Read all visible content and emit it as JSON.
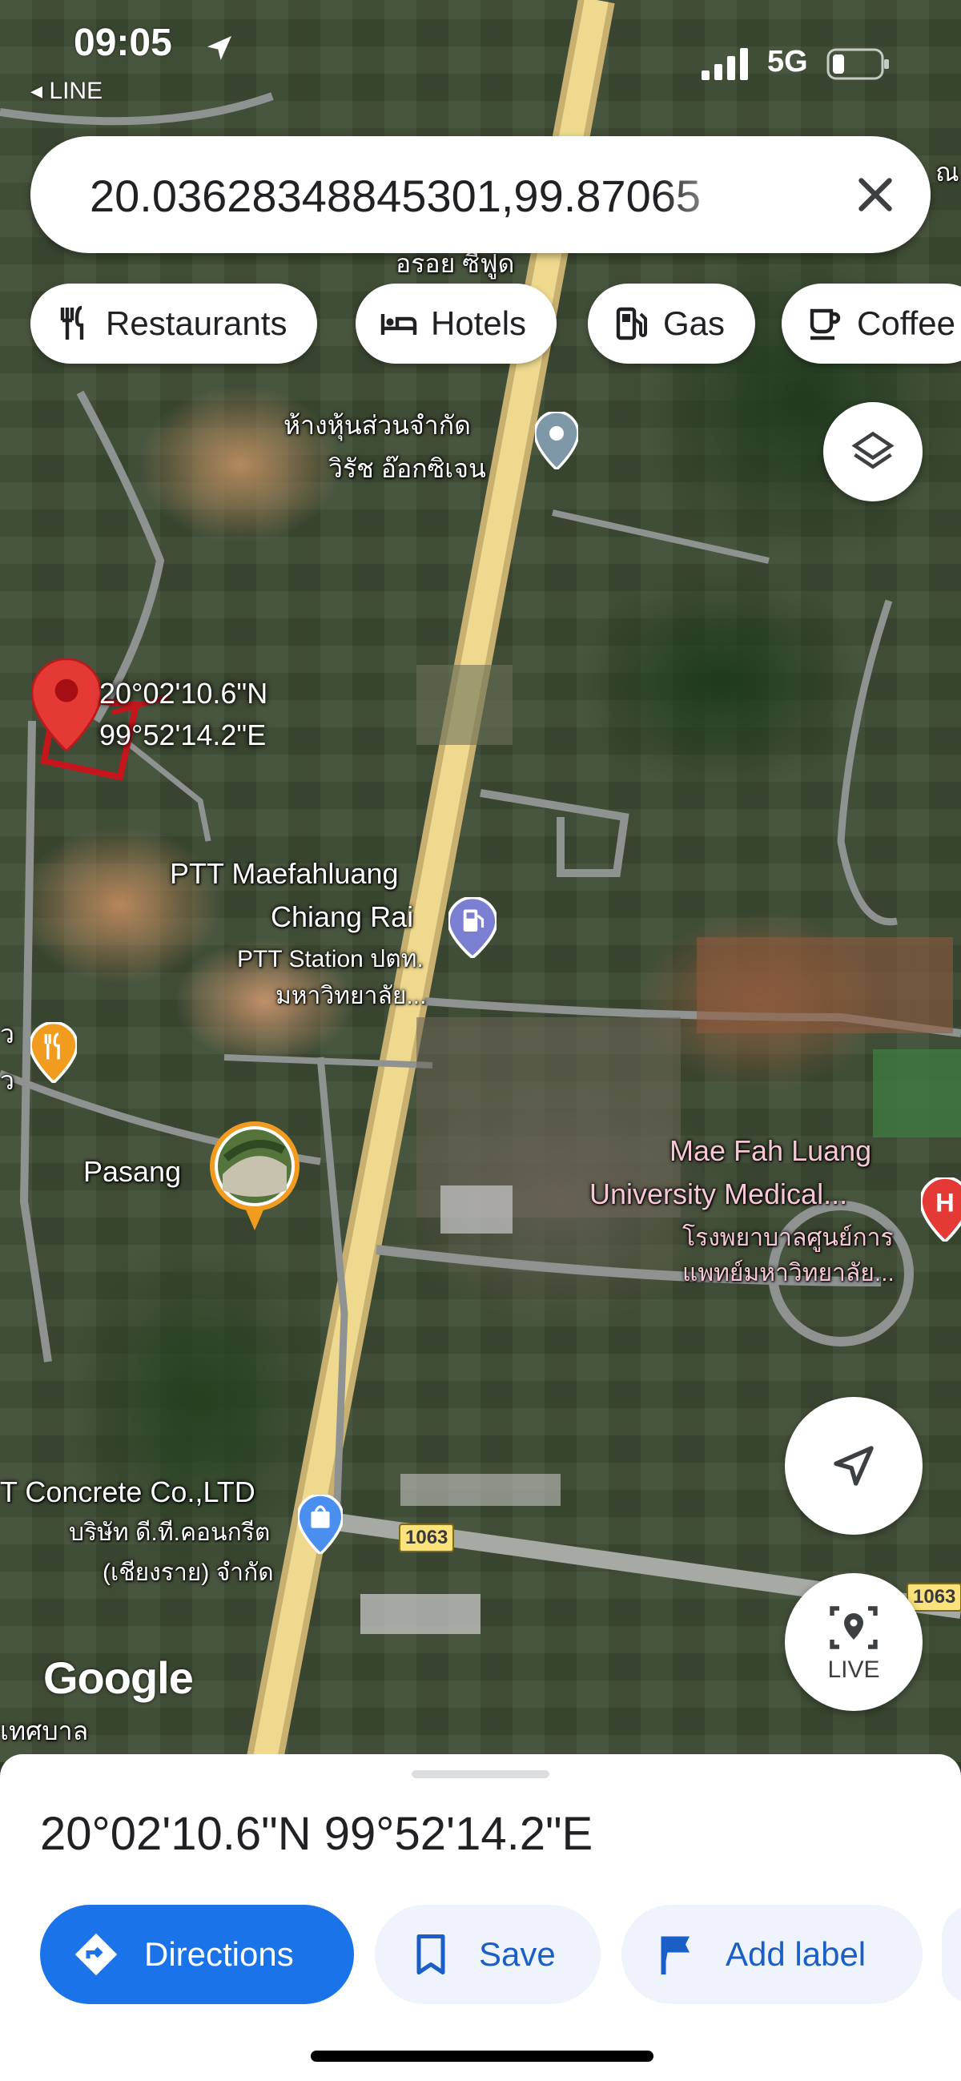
{
  "status_bar": {
    "time": "09:05",
    "back_app": "◂ LINE",
    "network": "5G"
  },
  "search": {
    "query": "20.03628348845301,99.87065"
  },
  "chips": [
    {
      "label": "Restaurants",
      "icon": "fork-knife-icon"
    },
    {
      "label": "Hotels",
      "icon": "bed-icon"
    },
    {
      "label": "Gas",
      "icon": "gas-pump-icon"
    },
    {
      "label": "Coffee",
      "icon": "coffee-cup-icon"
    }
  ],
  "map": {
    "labels": {
      "top_partial": "อรอย ซีฟูด",
      "top_right_partial": "ณ",
      "oxygen_line1": "ห้างหุ้นส่วนจำกัด",
      "oxygen_line2": "วิรัช อ๊อกซิเจน",
      "ptt_line1": "PTT Maefahluang",
      "ptt_line2": "Chiang Rai",
      "ptt_thai_line1": "PTT Station ปตท.",
      "ptt_thai_line2": "มหาวิทยาลัย...",
      "restaurant_partial_1": "ว",
      "restaurant_partial_2": "ว",
      "pasang": "Pasang",
      "hospital_line1": "Mae Fah Luang",
      "hospital_line2": "University Medical...",
      "hospital_thai_line1": "โรงพยาบาลศูนย์การ",
      "hospital_thai_line2": "แพทย์มหาวิทยาลัย...",
      "concrete_line1": "T Concrete Co.,LTD",
      "concrete_thai_line1": "บริษัท ดี.ที.คอนกรีต",
      "concrete_thai_line2": "(เชียงราย) จำกัด",
      "municipality_partial": "เทศบาล"
    },
    "pin_coords_line1": "20°02'10.6\"N",
    "pin_coords_line2": "99°52'14.2\"E",
    "road_shield_1": "1063",
    "road_shield_2": "1063",
    "logo": "Google",
    "live_label": "LIVE"
  },
  "sheet": {
    "coordinates": "20°02'10.6\"N 99°52'14.2\"E",
    "actions": [
      {
        "label": "Directions",
        "icon": "directions-icon"
      },
      {
        "label": "Save",
        "icon": "bookmark-icon"
      },
      {
        "label": "Add label",
        "icon": "flag-icon"
      }
    ]
  },
  "colors": {
    "accent": "#1a73e8",
    "pin": "#e53935",
    "road": "#f2d27a",
    "action_bg": "#eef3fc"
  }
}
